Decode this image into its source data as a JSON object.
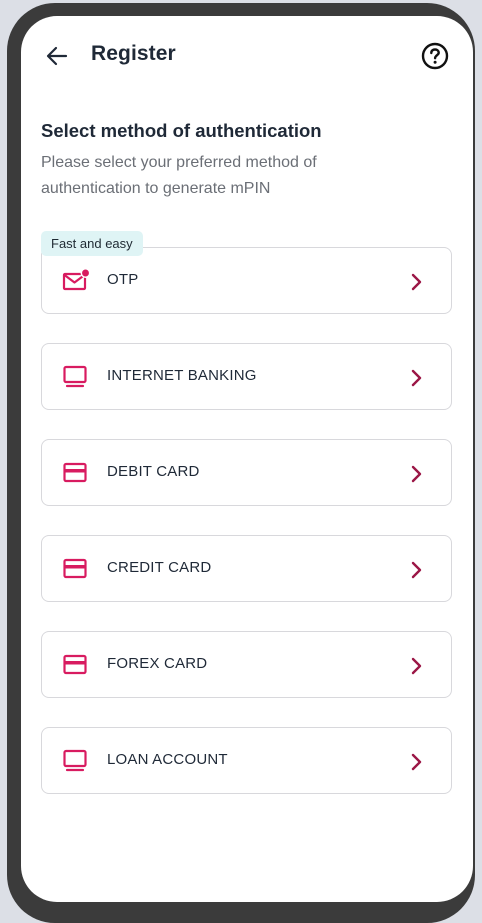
{
  "header": {
    "title": "Register",
    "back_icon": "arrow-left-icon",
    "help_icon": "question-circle-icon"
  },
  "intro": {
    "title": "Select method of authentication",
    "subtitle": "Please select your preferred method of authentication to generate mPIN"
  },
  "badge": {
    "label": "Fast and easy"
  },
  "options": [
    {
      "label": "OTP",
      "icon": "mail-notification-icon"
    },
    {
      "label": "INTERNET BANKING",
      "icon": "monitor-icon"
    },
    {
      "label": "DEBIT CARD",
      "icon": "credit-card-icon"
    },
    {
      "label": "CREDIT CARD",
      "icon": "credit-card-icon"
    },
    {
      "label": "FOREX CARD",
      "icon": "credit-card-icon"
    },
    {
      "label": "LOAN ACCOUNT",
      "icon": "monitor-icon"
    }
  ],
  "colors": {
    "accent": "#d81b60",
    "chevron": "#9b1646",
    "badge_bg": "#dff4f5",
    "text_primary": "#1f2937",
    "text_secondary": "#6b6f76"
  }
}
